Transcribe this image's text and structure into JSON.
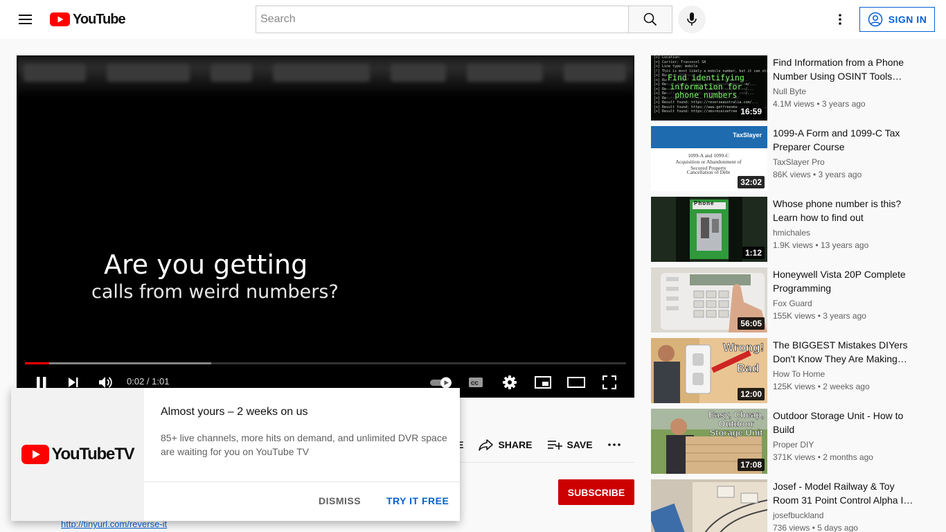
{
  "header": {
    "logo_text": "YouTube",
    "search_placeholder": "Search",
    "signin_label": "SIGN IN"
  },
  "player": {
    "overlay_line1": "Are you getting",
    "overlay_line2": "calls from weird numbers?",
    "time_display": "0:02 / 1:01",
    "progress_played_fraction": 0.04,
    "progress_buffered_fraction": 0.31
  },
  "actions": {
    "like_partial": "KE",
    "share_label": "SHARE",
    "save_label": "SAVE"
  },
  "subscribe_label": "SUBSCRIBE",
  "description_link": "http://tinyurl.com/reverse-it",
  "promo": {
    "logo_text": "YouTubeTV",
    "title": "Almost yours – 2 weeks on us",
    "body": "85+ live channels, more hits on demand, and unlimited DVR space are waiting for you on YouTube TV",
    "dismiss_label": "DISMISS",
    "try_label": "TRY IT FREE"
  },
  "thumb_text": {
    "t1_code": "[+] Location:\n[+] Carrier: Tracxxxxl SA\n[+] Line type: mobile\n[!] This is most likely a mobile number, but it can still be a VoIP\n[+] Running OVH scan...\n[+] Running OSINT footprint reconnaissance...\n[+] Result found: https://www.phonenumber.com/...\n[+] Result found: https://www.whitepages.com/...\n[+] Result found: https://www.truecaller.com/...\n[+] Result found: https://www.spytox.com/...\n[+] Result found: https://reverseaustralia.com/...\n[+] Result found: https://www.getfreesmsnumber.com/...\n[+] Result found: https://smsreceivefree.com/...",
    "t1_headline": "Find identifying\ninformation for\nphone numbers",
    "t2_brand": "TaxSlayer",
    "t2_line1": "1099-A and 1099-C\nAcquisition or Abandonment of\nSecured Property",
    "t2_line2": "Cancellation of Debt",
    "t3_sign": "Phone",
    "t5_text1": "Wrong!",
    "t5_text2": "Bad",
    "t6_text": "Easy, Cheap,\nOutdoor\nStorage Unit"
  },
  "recommendations": [
    {
      "title": "Find Information from a Phone Number Using OSINT Tools…",
      "channel": "Null Byte",
      "meta": "4.1M views • 3 years ago",
      "duration": "16:59"
    },
    {
      "title": "1099-A Form and 1099-C Tax Preparer Course",
      "channel": "TaxSlayer Pro",
      "meta": "86K views • 3 years ago",
      "duration": "32:02"
    },
    {
      "title": "Whose phone number is this? Learn how to find out",
      "channel": "hmichales",
      "meta": "1.9K views • 13 years ago",
      "duration": "1:12"
    },
    {
      "title": "Honeywell Vista 20P Complete Programming",
      "channel": "Fox Guard",
      "meta": "155K views • 3 years ago",
      "duration": "56:05"
    },
    {
      "title": "The BIGGEST Mistakes DIYers Don't Know They Are Making…",
      "channel": "How To Home",
      "meta": "125K views • 2 weeks ago",
      "duration": "12:00"
    },
    {
      "title": "Outdoor Storage Unit - How to Build",
      "channel": "Proper DIY",
      "meta": "371K views • 2 months ago",
      "duration": "17:08"
    },
    {
      "title": "Josef - Model Railway & Toy Room 31 Point Control Alpha I…",
      "channel": "josefbuckland",
      "meta": "736 views • 5 days ago",
      "duration": ""
    }
  ],
  "colors": {
    "brand_red": "#ff0000",
    "link_blue": "#065fd4",
    "subscribe_red": "#cc0000"
  }
}
